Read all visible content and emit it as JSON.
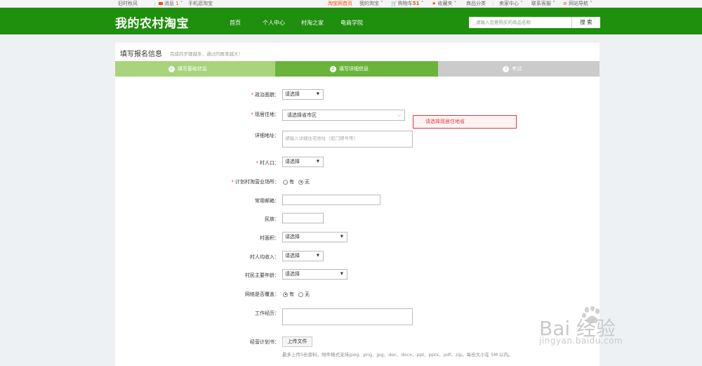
{
  "topbar": {
    "greeting": "旧时秋风",
    "messages_label": "消息",
    "messages_count": "1",
    "mobile": "手机逛淘宝",
    "taobao_home": "淘宝网首页",
    "my_taobao": "我的淘宝",
    "cart_label": "购物车",
    "cart_count": "51",
    "favorites": "收藏夹",
    "categories": "商品分类",
    "seller_center": "卖家中心",
    "contact": "联系客服",
    "site_nav": "网站导航"
  },
  "header": {
    "logo": "我的农村淘宝",
    "nav": [
      "首页",
      "个人中心",
      "村淘之家",
      "电商学院"
    ],
    "search_placeholder": "请输入您要购买的商品名称",
    "search_button": "搜 索"
  },
  "panel": {
    "title": "填写报名信息",
    "subtitle": "完成的步骤越多，通过的概率越大！",
    "steps": [
      {
        "label": "填写基础信息",
        "num": "✓"
      },
      {
        "label": "填写详细信息",
        "num": "2"
      },
      {
        "label": "考试",
        "num": "3"
      }
    ]
  },
  "form": {
    "political": {
      "label": "政治面貌：",
      "value": "请选择"
    },
    "residence": {
      "label": "现居住地：",
      "value": "请选择省市区"
    },
    "address": {
      "label": "详细地址：",
      "placeholder": "请输入详细住宅地址（如门牌号等）"
    },
    "population": {
      "label": "村人口：",
      "value": "请选择"
    },
    "plan_shop": {
      "label": "计划村淘营业场所：",
      "opt_yes": "有",
      "opt_no": "无"
    },
    "email": {
      "label": "常用邮箱："
    },
    "ethnicity": {
      "label": "民族："
    },
    "area": {
      "label": "村面积：",
      "value": "请选择"
    },
    "income": {
      "label": "村人均收入：",
      "value": "请选择"
    },
    "age": {
      "label": "村民主要年龄：",
      "value": "请选择"
    },
    "network": {
      "label": "网络是否覆盖：",
      "opt_yes": "有",
      "opt_no": "无"
    },
    "experience": {
      "label": "工作经历："
    },
    "plan": {
      "label": "经营计划书：",
      "button": "上传文件",
      "hint": "最多上传5份资料，附件格式支持jpeg、png、jpg、doc、docx、ppt、pptx、pdf、zip，每份大小在 5M 以内。"
    },
    "error": "请选择现居住地省"
  },
  "watermark": {
    "brand": "Bai 经验",
    "url": "jingyan.baidu.com"
  }
}
